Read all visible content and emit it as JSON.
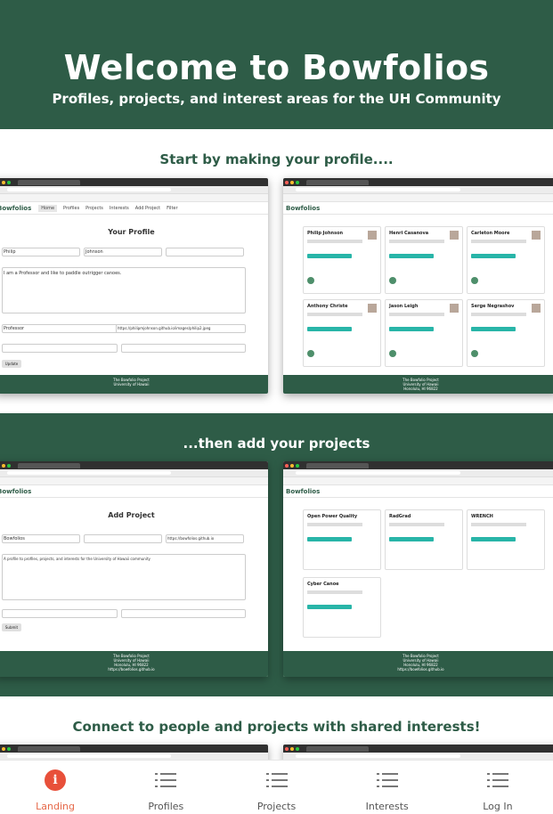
{
  "hero": {
    "title": "Welcome to Bowfolios",
    "subtitle": "Profiles, projects, and interest areas for the UH Community"
  },
  "sections": [
    {
      "title": "Start by making your profile...."
    },
    {
      "title": "...then add your projects"
    },
    {
      "title": "Connect to people and projects with shared interests!"
    }
  ],
  "screenshots": {
    "profile_form": {
      "brand": "Bowfolios",
      "nav": [
        "Home",
        "Profiles",
        "Projects",
        "Interests",
        "Add Project",
        "Filter"
      ],
      "heading": "Your Profile",
      "first_value": "Philip",
      "last_value": "Johnson",
      "bio_value": "I am a Professor and like to paddle outrigger canoes.",
      "title_value": "Professor",
      "picture_value": "https://philipmjohnson.github.io/images/philip2.jpeg",
      "button": "Update",
      "footer": "The Bowfolio Project\nUniversity of Hawaii"
    },
    "profiles_list": {
      "brand": "Bowfolios",
      "names": [
        "Philip Johnson",
        "Henri Casanova",
        "Carleton Moore",
        "Anthony Christe",
        "Jason Leigh",
        "Serge Negrashov"
      ],
      "footer": "The Bowfolio Project\nUniversity of Hawaii\nHonolulu, HI 96822"
    },
    "add_project": {
      "brand": "Bowfolios",
      "heading": "Add Project",
      "name_value": "Bowfolios",
      "homepage_value": "https://bowfolios.github.io",
      "description_value": "A profile to profiles, projects, and interests for the University of Hawaii community",
      "button": "Submit",
      "footer": "The Bowfolio Project\nUniversity of Hawaii\nHonolulu, HI 96822\nhttps://bowfolios.github.io"
    },
    "projects_list": {
      "brand": "Bowfolios",
      "projects": [
        "Open Power Quality",
        "RadGrad",
        "WRENCH",
        "Cyber Canoe"
      ],
      "footer": "The Bowfolio Project\nUniversity of Hawaii\nHonolulu, HI 96822\nhttps://bowfolios.github.io"
    }
  },
  "bottom_nav": [
    {
      "label": "Landing",
      "icon": "info-icon",
      "active": true
    },
    {
      "label": "Profiles",
      "icon": "list-icon",
      "active": false
    },
    {
      "label": "Projects",
      "icon": "list-icon",
      "active": false
    },
    {
      "label": "Interests",
      "icon": "list-icon",
      "active": false
    },
    {
      "label": "Log In",
      "icon": "list-icon",
      "active": false
    }
  ],
  "colors": {
    "brand_green": "#2e5c47",
    "accent_orange": "#e8503a",
    "tag_teal": "#28b5a8"
  }
}
